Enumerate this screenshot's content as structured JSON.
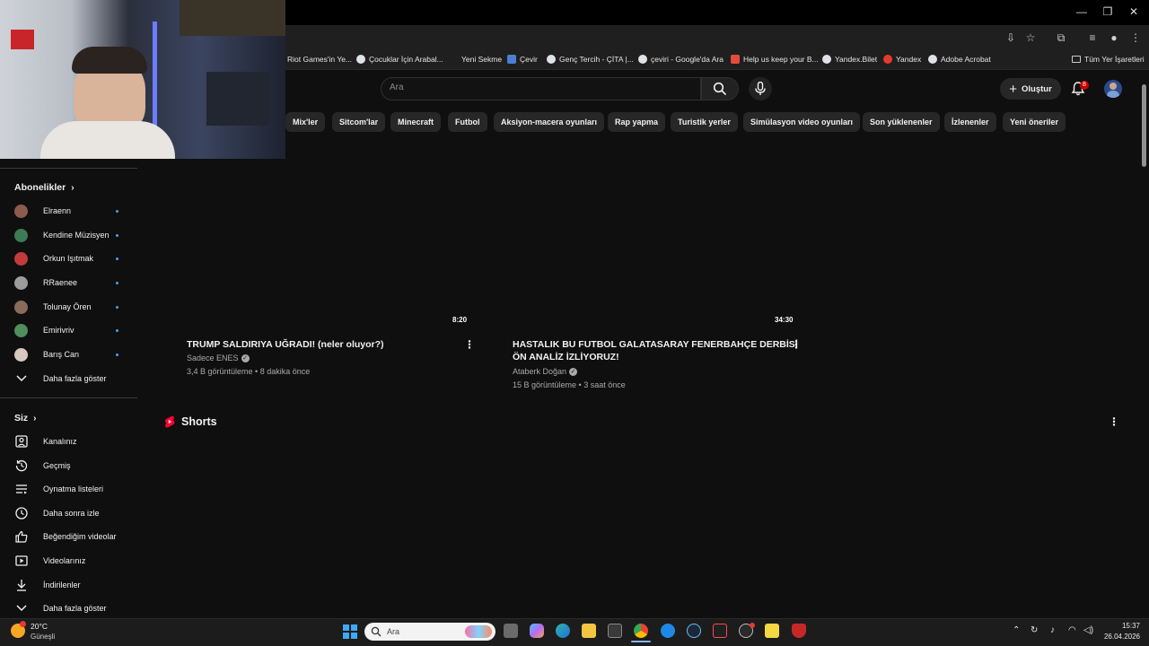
{
  "bookmarks": [
    {
      "label": "Riot Games'in Ye..."
    },
    {
      "label": "Çocuklar İçin Arabal..."
    },
    {
      "label": "Yeni Sekme"
    },
    {
      "label": "Çevir"
    },
    {
      "label": "Genç Tercih - ÇİTA |..."
    },
    {
      "label": "çeviri - Google'da Ara"
    },
    {
      "label": "Help us keep your B..."
    },
    {
      "label": "Yandex.Bilet"
    },
    {
      "label": "Yandex"
    },
    {
      "label": "Adobe Acrobat"
    },
    {
      "label": "Tüm Yer İşaretleri"
    }
  ],
  "header": {
    "search_placeholder": "Ara",
    "create_label": "Oluştur",
    "notification_count": "8"
  },
  "chips": [
    "Mix'ler",
    "Sitcom'lar",
    "Minecraft",
    "Futbol",
    "Aksiyon-macera oyunları",
    "Rap yapma",
    "Turistik yerler",
    "Simülasyon video oyunları",
    "Son yüklenenler",
    "İzlenenler",
    "Yeni öneriler"
  ],
  "sidebar": {
    "subscriptions_title": "Abonelikler",
    "subscriptions": [
      {
        "name": "Elraenn"
      },
      {
        "name": "Kendine Müzisyen"
      },
      {
        "name": "Orkun Işıtmak"
      },
      {
        "name": "RRaenee"
      },
      {
        "name": "Tolunay Ören"
      },
      {
        "name": "Emirivriv"
      },
      {
        "name": "Barış Can"
      }
    ],
    "show_more_subs": "Daha fazla göster",
    "you_title": "Siz",
    "you_items": [
      {
        "label": "Kanalınız"
      },
      {
        "label": "Geçmiş"
      },
      {
        "label": "Oynatma listeleri"
      },
      {
        "label": "Daha sonra izle"
      },
      {
        "label": "Beğendiğim videolar"
      },
      {
        "label": "Videolarınız"
      },
      {
        "label": "İndirilenler"
      }
    ],
    "show_more_you": "Daha fazla göster"
  },
  "videos": [
    {
      "duration": "8:20",
      "title": "TRUMP SALDIRIYA UĞRADI! (neler oluyor?)",
      "channel": "Sadece ENES",
      "meta": "3,4 B görüntüleme • 8 dakika önce"
    },
    {
      "duration": "34:30",
      "title_line1": "HASTALIK BU FUTBOL GALATASARAY FENERBAHÇE DERBİSİ",
      "title_line2": "ÖN ANALİZ İZLİYORUZ!",
      "channel": "Ataberk Doğan",
      "meta": "15 B görüntüleme • 3 saat önce"
    }
  ],
  "shorts_title": "Shorts",
  "taskbar": {
    "weather_temp": "20°C",
    "weather_desc": "Güneşli",
    "search_placeholder": "Ara",
    "time": "15:37",
    "date": "26.04.2026"
  },
  "colors": {
    "background": "#0f0f0f",
    "chip": "#272727",
    "accent_red": "#ff0000",
    "verified": "#aaaaaa"
  }
}
